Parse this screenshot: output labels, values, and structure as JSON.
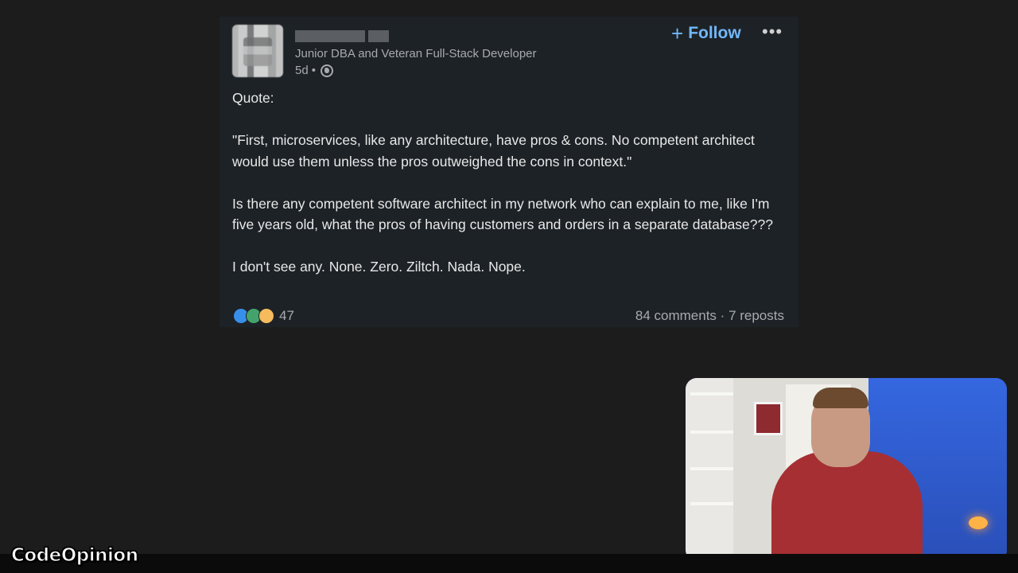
{
  "post": {
    "headline": "Junior DBA and Veteran Full-Stack Developer",
    "time": "5d",
    "separator": "•",
    "follow_label": "Follow",
    "follow_plus": "+",
    "more_label": "•••",
    "body": [
      "Quote:",
      "\"First, microservices, like any architecture, have pros & cons. No competent architect would use them unless the pros outweighed the cons in context.\"",
      "Is there any competent software architect in my network who can explain to me, like I'm five years old, what the pros of having customers and orders in a separate database???",
      "I don't see any. None. Zero. Ziltch. Nada. Nope."
    ],
    "reactions": {
      "icons": [
        "like-icon",
        "celebrate-icon",
        "insightful-icon"
      ],
      "count": "47"
    },
    "stats": {
      "comments": "84 comments",
      "dot": "·",
      "reposts": "7 reposts"
    }
  },
  "overlay": {
    "logo": "CodeOpinion"
  },
  "colors": {
    "card_bg": "#1d2226",
    "page_bg": "#1c1c1c",
    "follow_blue": "#71b7fb",
    "muted_text": "#a8abad",
    "body_text": "#e8e8e8"
  }
}
